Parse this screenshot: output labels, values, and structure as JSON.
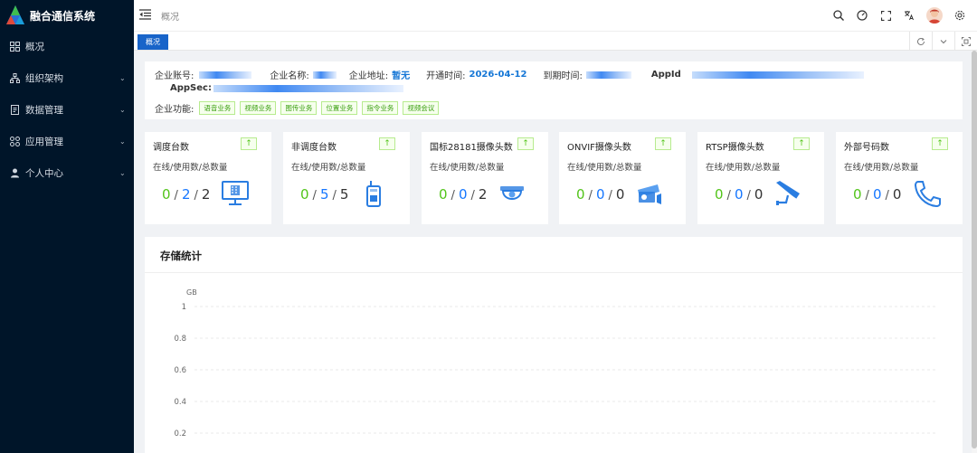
{
  "app": {
    "title": "融合通信系统"
  },
  "sidebar": {
    "items": [
      {
        "label": "概况",
        "icon": "dashboard-icon",
        "expandable": false
      },
      {
        "label": "组织架构",
        "icon": "org-icon",
        "expandable": true
      },
      {
        "label": "数据管理",
        "icon": "data-icon",
        "expandable": true
      },
      {
        "label": "应用管理",
        "icon": "apps-icon",
        "expandable": true
      },
      {
        "label": "个人中心",
        "icon": "user-icon",
        "expandable": true
      }
    ]
  },
  "topbar": {
    "breadcrumb": "概况"
  },
  "tabs": {
    "active": "概况"
  },
  "info": {
    "account_label": "企业账号:",
    "name_label": "企业名称:",
    "address_label": "企业地址:",
    "address_value": "暂无",
    "open_label": "开通时间:",
    "open_value": "2026-04-12",
    "expire_label": "到期时间:",
    "appid_label": "AppId",
    "appsec_label": "AppSec:",
    "features_label": "企业功能:",
    "features": [
      "语音业务",
      "视频业务",
      "图传业务",
      "位置业务",
      "指令业务",
      "视频会议"
    ]
  },
  "cards": [
    {
      "title": "调度台数",
      "subtitle": "在线/使用数/总数量",
      "online": "0",
      "used": "2",
      "total": "2",
      "icon": "monitor-icon"
    },
    {
      "title": "非调度台数",
      "subtitle": "在线/使用数/总数量",
      "online": "0",
      "used": "5",
      "total": "5",
      "icon": "walkie-talkie-icon"
    },
    {
      "title": "国标28181摄像头数",
      "subtitle": "在线/使用数/总数量",
      "online": "0",
      "used": "0",
      "total": "2",
      "icon": "dome-camera-icon"
    },
    {
      "title": "ONVIF摄像头数",
      "subtitle": "在线/使用数/总数量",
      "online": "0",
      "used": "0",
      "total": "0",
      "icon": "bullet-camera-icon"
    },
    {
      "title": "RTSP摄像头数",
      "subtitle": "在线/使用数/总数量",
      "online": "0",
      "used": "0",
      "total": "0",
      "icon": "cctv-camera-icon"
    },
    {
      "title": "外部号码数",
      "subtitle": "在线/使用数/总数量",
      "online": "0",
      "used": "0",
      "total": "0",
      "icon": "phone-icon"
    }
  ],
  "storage": {
    "title": "存储统计"
  },
  "chart_data": {
    "type": "line",
    "ylabel": "GB",
    "ylim": [
      0,
      1
    ],
    "yticks": [
      "1",
      "0.8",
      "0.6",
      "0.4",
      "0.2"
    ],
    "series": [],
    "grid": true
  }
}
